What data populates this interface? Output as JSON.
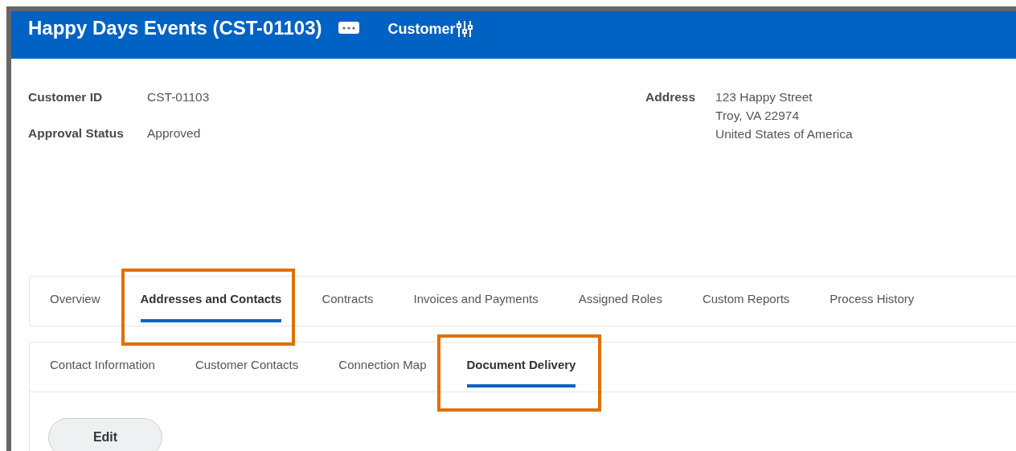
{
  "header": {
    "title": "Happy Days Events (CST-01103)",
    "subtitle": "Customer"
  },
  "details": {
    "left": [
      {
        "label": "Customer ID",
        "value": "CST-01103"
      },
      {
        "label": "Approval Status",
        "value": "Approved"
      }
    ],
    "address": {
      "label": "Address",
      "lines": [
        "123 Happy Street",
        "Troy, VA 22974",
        "United States of America"
      ]
    }
  },
  "tabs": [
    {
      "label": "Overview",
      "selected": false,
      "highlighted": false
    },
    {
      "label": "Addresses and Contacts",
      "selected": true,
      "highlighted": true
    },
    {
      "label": "Contracts",
      "selected": false,
      "highlighted": false
    },
    {
      "label": "Invoices and Payments",
      "selected": false,
      "highlighted": false
    },
    {
      "label": "Assigned Roles",
      "selected": false,
      "highlighted": false
    },
    {
      "label": "Custom Reports",
      "selected": false,
      "highlighted": false
    },
    {
      "label": "Process History",
      "selected": false,
      "highlighted": false
    }
  ],
  "subtabs": [
    {
      "label": "Contact Information",
      "selected": false,
      "highlighted": false
    },
    {
      "label": "Customer Contacts",
      "selected": false,
      "highlighted": false
    },
    {
      "label": "Connection Map",
      "selected": false,
      "highlighted": false
    },
    {
      "label": "Document Delivery",
      "selected": true,
      "highlighted": true
    }
  ],
  "buttons": [
    "Edit"
  ]
}
